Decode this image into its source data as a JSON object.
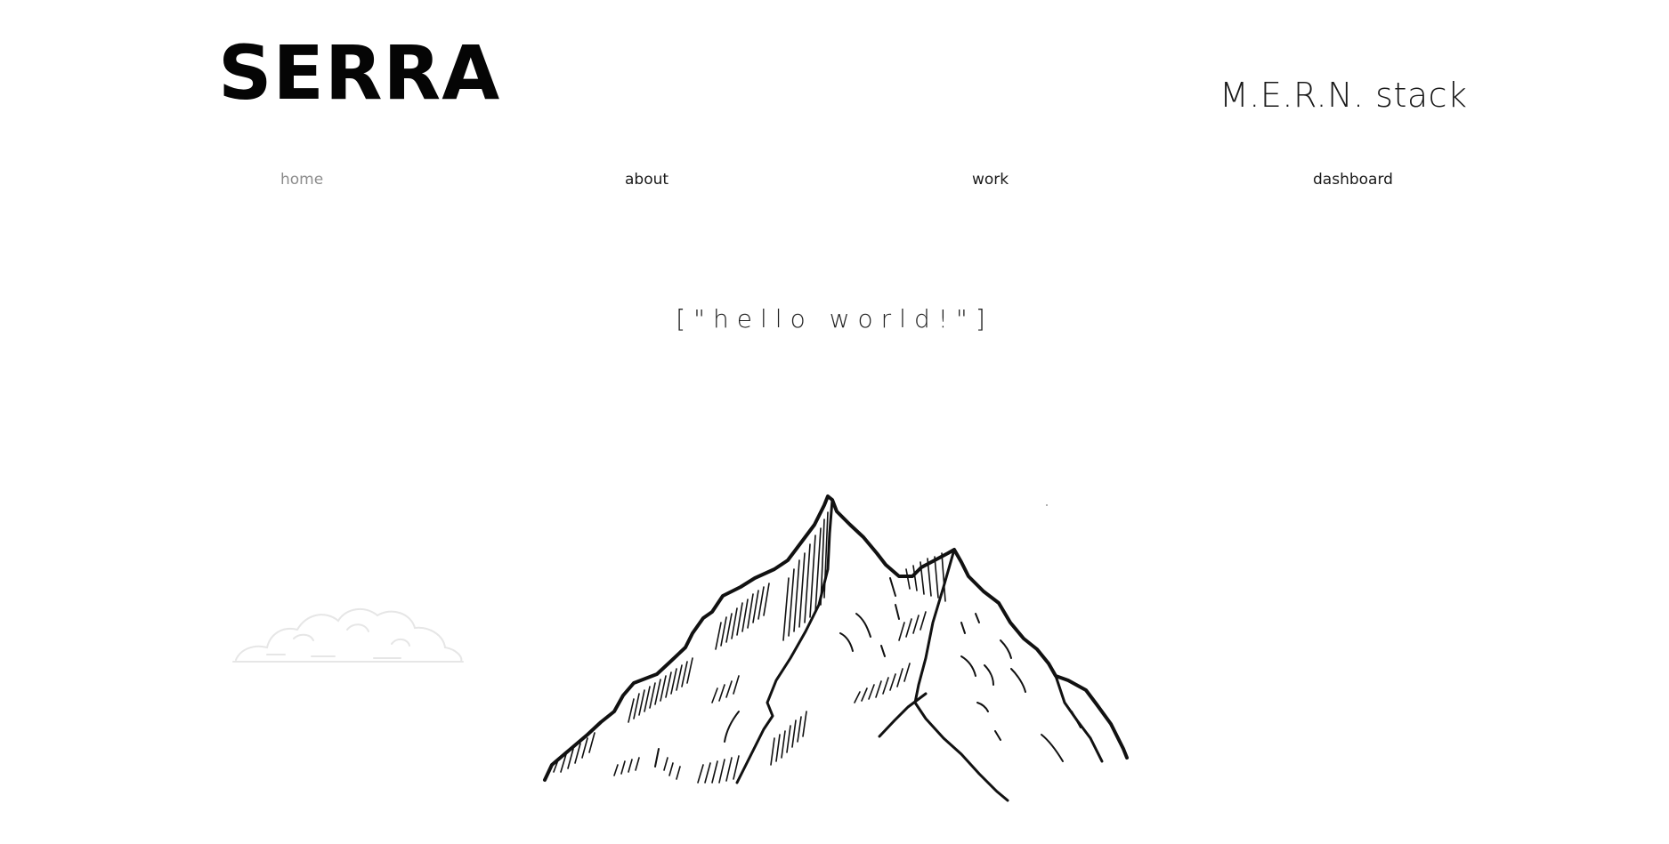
{
  "header": {
    "logo": "SERRA",
    "tagline": "M.E.R.N. stack"
  },
  "nav": {
    "home": "home",
    "about": "about",
    "work": "work",
    "dashboard": "dashboard"
  },
  "hero": {
    "text": "[\"hello world!\"]"
  },
  "colors": {
    "background": "#ffffff",
    "text": "#111111",
    "nav_active": "#8c8c8c",
    "cloud": "#e6e6e6"
  }
}
